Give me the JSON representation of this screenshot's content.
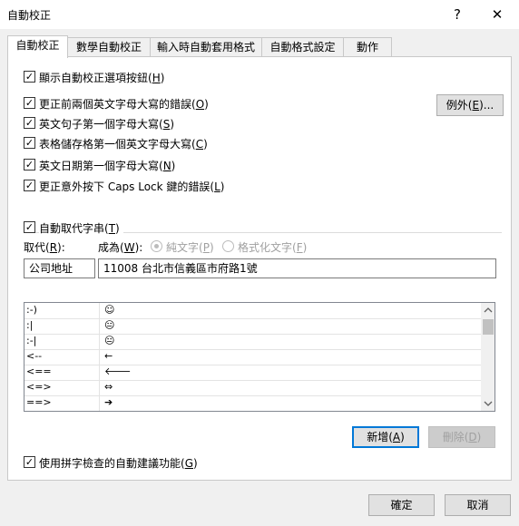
{
  "window": {
    "title": "自動校正",
    "help_label": "?",
    "close_label": "✕"
  },
  "tabs": [
    {
      "label": "自動校正"
    },
    {
      "label": "數學自動校正"
    },
    {
      "label": "輸入時自動套用格式"
    },
    {
      "label": "自動格式設定"
    },
    {
      "label": "動作"
    }
  ],
  "options": [
    {
      "pre": "顯示自動校正選項按鈕(",
      "key": "H",
      "post": ")",
      "checked": true
    },
    {
      "pre": "更正前兩個英文字母大寫的錯誤(",
      "key": "O",
      "post": ")",
      "checked": true
    },
    {
      "pre": "英文句子第一個字母大寫(",
      "key": "S",
      "post": ")",
      "checked": true
    },
    {
      "pre": "表格儲存格第一個英文字母大寫(",
      "key": "C",
      "post": ")",
      "checked": true
    },
    {
      "pre": "英文日期第一個字母大寫(",
      "key": "N",
      "post": ")",
      "checked": true
    },
    {
      "pre": "更正意外按下 Caps Lock 鍵的錯誤(",
      "key": "L",
      "post": ")",
      "checked": true
    }
  ],
  "exceptions_button": {
    "pre": "例外(",
    "key": "E",
    "post": ")..."
  },
  "replace_group": {
    "checkbox": {
      "pre": "自動取代字串(",
      "key": "T",
      "post": ")",
      "checked": true
    },
    "replace_label": {
      "pre": "取代(",
      "key": "R",
      "post": "):"
    },
    "with_label": {
      "pre": "成為(",
      "key": "W",
      "post": "):"
    },
    "plain_text": {
      "pre": "純文字(",
      "key": "P",
      "post": ")"
    },
    "formatted_text": {
      "pre": "格式化文字(",
      "key": "F",
      "post": ")"
    },
    "replace_value": "公司地址",
    "with_value": "11008 台北市信義區市府路1號"
  },
  "entries": [
    {
      "from": ":-)",
      "to": "☺"
    },
    {
      "from": ":|",
      "to": "😐"
    },
    {
      "from": ":-|",
      "to": "😐"
    },
    {
      "from": "<--",
      "to": "←"
    },
    {
      "from": "<==",
      "to": "🡐"
    },
    {
      "from": "<=>",
      "to": "⇔"
    },
    {
      "from": "==>",
      "to": "➔"
    }
  ],
  "add_button": {
    "pre": "新增(",
    "key": "A",
    "post": ")"
  },
  "delete_button": {
    "pre": "刪除(",
    "key": "D",
    "post": ")"
  },
  "spell_checkbox": {
    "pre": "使用拼字檢查的自動建議功能(",
    "key": "G",
    "post": ")",
    "checked": true
  },
  "ok_label": "確定",
  "cancel_label": "取消"
}
